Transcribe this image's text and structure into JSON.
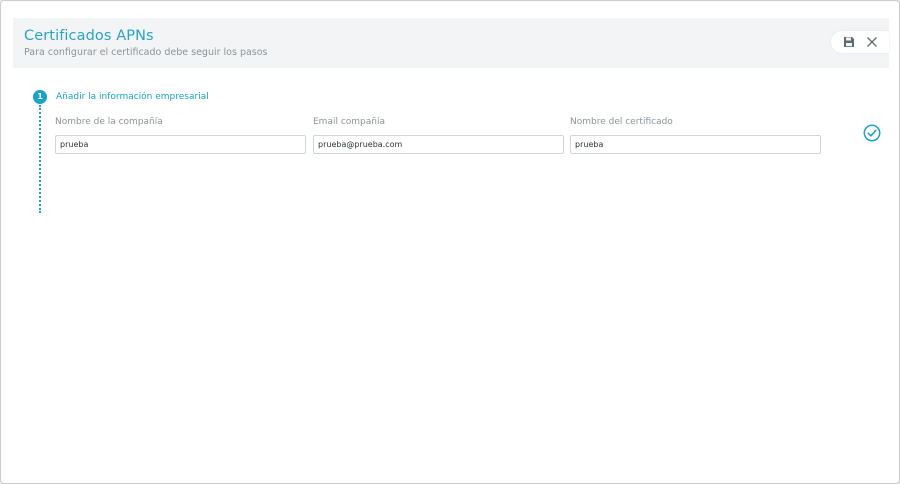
{
  "header": {
    "title": "Certificados APNs",
    "subtitle": "Para configurar el certificado debe seguir los pasos"
  },
  "actions": {
    "save_icon": "save-icon",
    "close_icon": "close-icon"
  },
  "step": {
    "number": "1",
    "title": "Añadir la información empresarial"
  },
  "fields": [
    {
      "label": "Nombre de la compañía",
      "value": "prueba"
    },
    {
      "label": "Email compañía",
      "value": "prueba@prueba.com"
    },
    {
      "label": "Nombre del certificado",
      "value": "prueba"
    }
  ],
  "confirm_icon": "check-circle-icon",
  "colors": {
    "accent": "#1aa3c7",
    "muted_text": "#8b949b",
    "header_bg": "#f3f4f5"
  }
}
